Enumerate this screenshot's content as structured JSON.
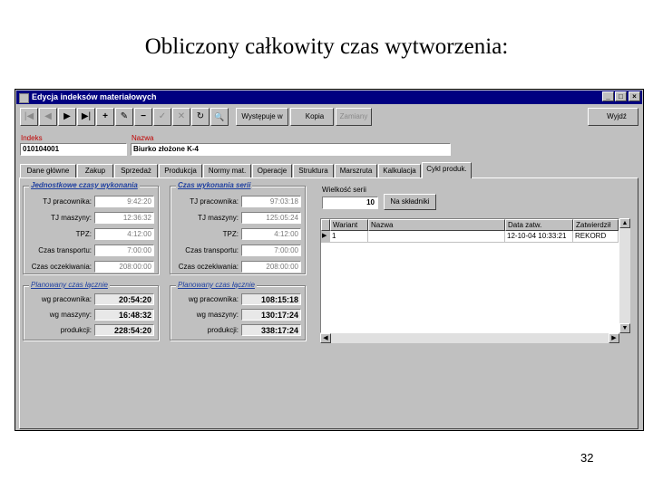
{
  "slide": {
    "title": "Obliczony całkowity czas wytworzenia:",
    "page_number": "32"
  },
  "window": {
    "title": "Edycja indeksów materiałowych",
    "buttons": {
      "minimize": "_",
      "maximize": "□",
      "close": "×"
    }
  },
  "toolbar": {
    "first": "|◀",
    "prev": "◀",
    "next": "▶",
    "last": "▶|",
    "add": "+",
    "edit": "✎",
    "delete": "−",
    "confirm": "✓",
    "cancel": "✕",
    "refresh": "↻",
    "find": "🔍",
    "occurs_in": "Występuje w",
    "copy": "Kopia",
    "replacements": "Zamiany",
    "exit": "Wyjdź"
  },
  "header": {
    "index_label": "Indeks",
    "index_value": "010104001",
    "name_label": "Nazwa",
    "name_value": "Biurko złożone  K-4"
  },
  "tabs": [
    "Dane główne",
    "Zakup",
    "Sprzedaż",
    "Produkcja",
    "Normy mat.",
    "Operacje",
    "Struktura",
    "Marszruta",
    "Kalkulacja",
    "Cykl produk."
  ],
  "unit_times": {
    "title": "Jednostkowe czasy wykonania",
    "rows": [
      {
        "label": "TJ pracownika:",
        "value": "9:42:20"
      },
      {
        "label": "TJ maszyny:",
        "value": "12:36:32"
      },
      {
        "label": "TPZ:",
        "value": "4:12:00"
      },
      {
        "label": "Czas transportu:",
        "value": "7:00:00"
      },
      {
        "label": "Czas oczekiwania:",
        "value": "208:00:00"
      }
    ]
  },
  "series_times": {
    "title": "Czas wykonania serii",
    "rows": [
      {
        "label": "TJ pracownika:",
        "value": "97:03:18"
      },
      {
        "label": "TJ maszyny:",
        "value": "125:05:24"
      },
      {
        "label": "TPZ:",
        "value": "4:12:00"
      },
      {
        "label": "Czas transportu:",
        "value": "7:00:00"
      },
      {
        "label": "Czas oczekiwania:",
        "value": "208:00:00"
      }
    ]
  },
  "planned_unit": {
    "title": "Planowany czas łącznie",
    "rows": [
      {
        "label": "wg pracownika:",
        "value": "20:54:20"
      },
      {
        "label": "wg maszyny:",
        "value": "16:48:32"
      },
      {
        "label": "produkcji:",
        "value": "228:54:20"
      }
    ]
  },
  "planned_series": {
    "title": "Planowany czas łącznie",
    "rows": [
      {
        "label": "wg pracownika:",
        "value": "108:15:18"
      },
      {
        "label": "wg maszyny:",
        "value": "130:17:24"
      },
      {
        "label": "produkcji:",
        "value": "338:17:24"
      }
    ]
  },
  "series": {
    "label": "Wielkość serii",
    "value": "10",
    "button": "Na składniki"
  },
  "grid": {
    "columns": [
      "Wariant",
      "Nazwa",
      "Data zatw.",
      "Zatwierdził"
    ],
    "rows": [
      {
        "marker": "▶",
        "variant": "1",
        "name": "",
        "date": "12-10-04 10:33:21",
        "approved_by": "REKORD"
      }
    ]
  },
  "colors": {
    "titlebar": "#000080",
    "group_title": "#1e3fa0",
    "label_red": "#c00000",
    "window_bg": "#c0c0c0"
  }
}
